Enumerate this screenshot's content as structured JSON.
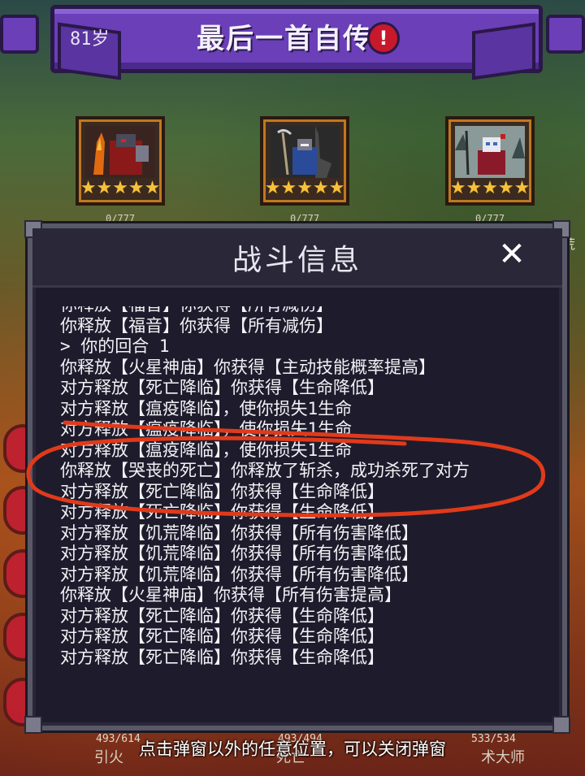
{
  "header": {
    "age": "81岁",
    "title": "最后一首自传",
    "warning_icon": "!"
  },
  "heroes": [
    {
      "stars": "★★★★★",
      "count": "0/777"
    },
    {
      "stars": "★★★★★",
      "count": "0/777"
    },
    {
      "stars": "★★★★★",
      "count": "0/777"
    }
  ],
  "side_label": "荒",
  "dialog": {
    "title": "战斗信息",
    "close_label": "✕",
    "log": [
      "你释放【福音】你获得【所有减伤】",
      "你释放【福音】你获得【所有减伤】",
      "> 你的回合 1",
      "你释放【火星神庙】你获得【主动技能概率提高】",
      "对方释放【死亡降临】你获得【生命降低】",
      "对方释放【瘟疫降临】，使你损失1生命",
      "对方释放【瘟疫降临】，使你损失1生命",
      "对方释放【瘟疫降临】，使你损失1生命",
      "你释放【哭丧的死亡】你释放了斩杀，成功杀死了对方",
      "对方释放【死亡降临】你获得【生命降低】",
      "对方释放【死亡降临】你获得【生命降低】",
      "对方释放【饥荒降临】你获得【所有伤害降低】",
      "对方释放【饥荒降临】你获得【所有伤害降低】",
      "对方释放【饥荒降临】你获得【所有伤害降低】",
      "你释放【火星神庙】你获得【所有伤害提高】",
      "对方释放【死亡降临】你获得【生命降低】",
      "对方释放【死亡降临】你获得【生命降低】",
      "对方释放【死亡降临】你获得【生命降低】"
    ]
  },
  "footer": {
    "hint": "点击弹窗以外的任意位置，可以关闭弹窗",
    "stat_left": "493/614",
    "stat_mid": "493/494",
    "stat_right": "533/534",
    "name_left": "引火",
    "name_mid": "死亡",
    "name_right": "术大师"
  },
  "colors": {
    "annotation": "#e03a1a",
    "banner": "#6a3fb8",
    "star": "#f6c23a"
  }
}
